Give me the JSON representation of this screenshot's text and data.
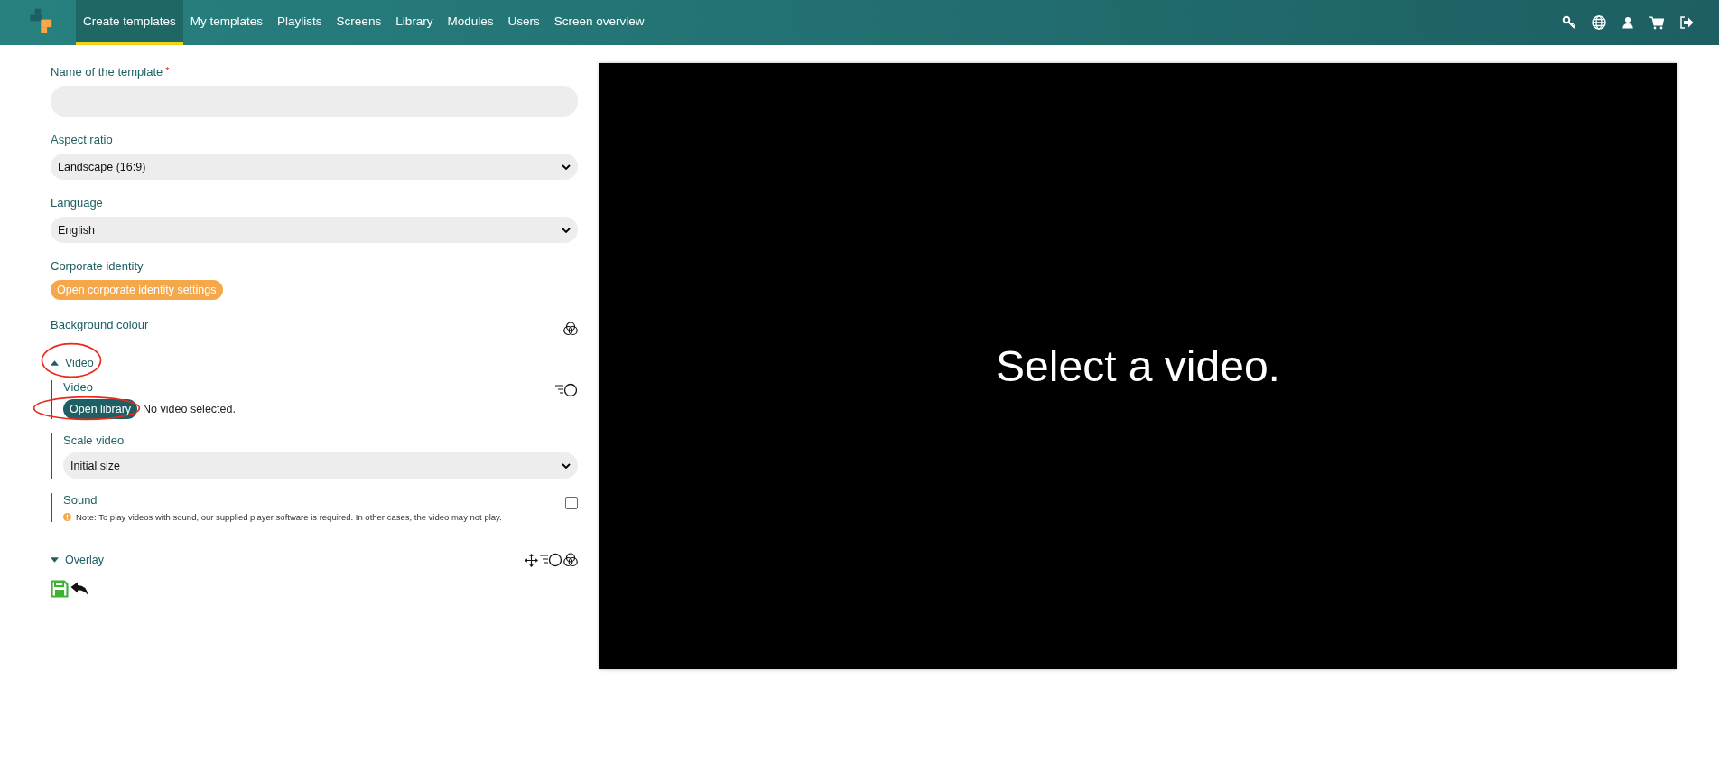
{
  "nav": {
    "items": [
      {
        "label": "Create templates",
        "selected": true
      },
      {
        "label": "My templates",
        "selected": false
      },
      {
        "label": "Playlists",
        "selected": false
      },
      {
        "label": "Screens",
        "selected": false
      },
      {
        "label": "Library",
        "selected": false
      },
      {
        "label": "Modules",
        "selected": false
      },
      {
        "label": "Users",
        "selected": false
      },
      {
        "label": "Screen overview",
        "selected": false
      }
    ]
  },
  "form": {
    "name_field": {
      "label": "Name of the template",
      "required_mark": "*"
    },
    "aspect_ratio": {
      "label": "Aspect ratio",
      "value": "Landscape (16:9)"
    },
    "language": {
      "label": "Language",
      "value": "English"
    },
    "corporate_identity": {
      "label": "Corporate identity",
      "button": "Open corporate identity settings"
    },
    "background_colour": {
      "label": "Background colour"
    },
    "video_section": {
      "title": "Video",
      "expanded": true,
      "circled": true,
      "video": {
        "label": "Video",
        "button": "Open library",
        "button_circled": true,
        "status": "No video selected."
      },
      "scale_video": {
        "label": "Scale video",
        "value": "Initial size"
      },
      "sound": {
        "label": "Sound",
        "checked": false,
        "note": "Note: To play videos with sound, our supplied player software is required.  In other cases, the video may not play."
      }
    },
    "overlay_section": {
      "title": "Overlay",
      "expanded": false
    }
  },
  "preview": {
    "message": "Select a video."
  }
}
